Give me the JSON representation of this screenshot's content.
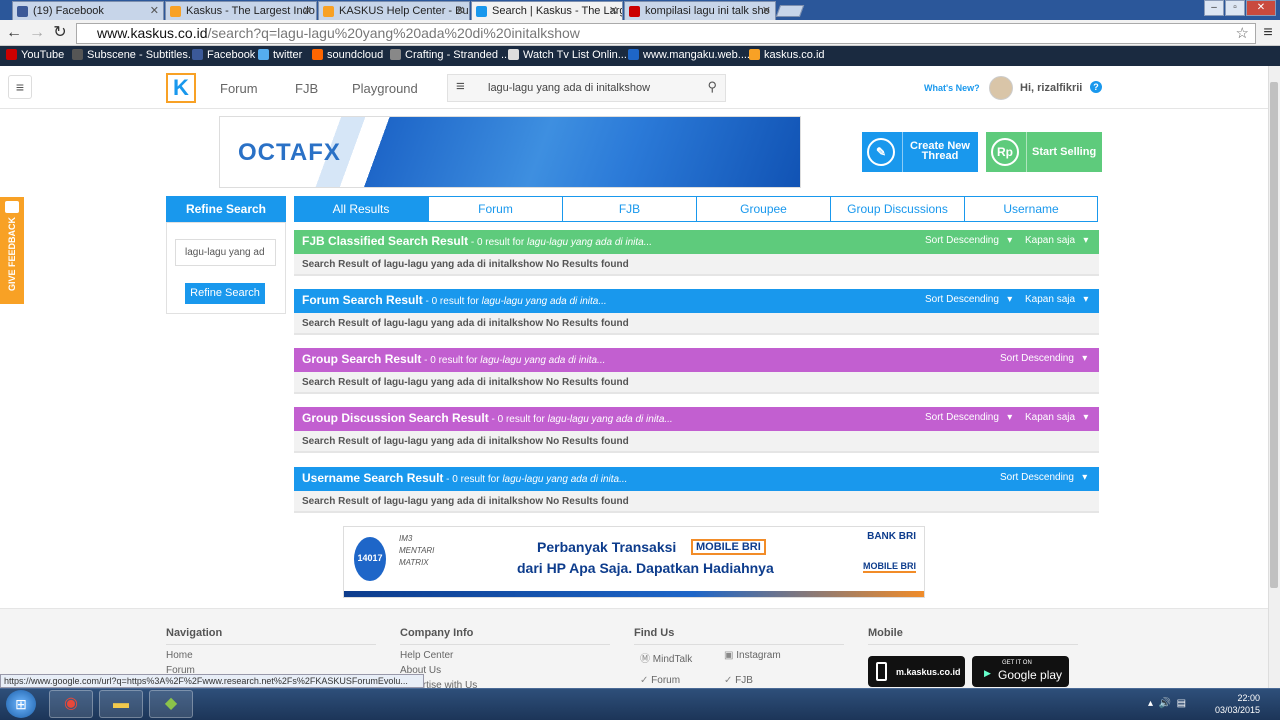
{
  "browser": {
    "tabs": [
      {
        "title": "(19) Facebook",
        "color": "#3b5998"
      },
      {
        "title": "Kaskus - The Largest Indo",
        "color": "#f8a125"
      },
      {
        "title": "KASKUS Help Center - Bu",
        "color": "#f8a125"
      },
      {
        "title": "Search | Kaskus - The Larg",
        "color": "#1998ed"
      },
      {
        "title": "kompilasi lagu ini talk sho",
        "color": "#cc0000"
      }
    ],
    "url_host": "www.kaskus.co.id",
    "url_rest": "/search?q=lagu-lagu%20yang%20ada%20di%20initalkshow",
    "bookmarks": [
      "YouTube",
      "Subscene - Subtitles...",
      "Facebook",
      "twitter",
      "soundcloud",
      "Crafting - Stranded ...",
      "Watch Tv List Onlin...",
      "www.mangaku.web....",
      "kaskus.co.id"
    ]
  },
  "header": {
    "logo": "K",
    "nav": [
      "Forum",
      "FJB",
      "Playground"
    ],
    "search_value": "lagu-lagu yang ada di initalkshow",
    "whats_new": "What's New?",
    "greeting": "Hi, rizalfikrii",
    "help": "?"
  },
  "ads": {
    "octafx": "OCTAFX",
    "bri_line1": "Perbanyak Transaksi",
    "bri_mobile": "MOBILE BRI",
    "bri_line2": "dari HP Apa Saja. Dapatkan Hadiahnya",
    "bri_phone": "14017",
    "bri_bank": "BANK BRI",
    "bri_mobile2": "MOBILE BRI",
    "bri_logo1": "IM3",
    "bri_logo2": "MENTARI",
    "bri_logo3": "MATRIX"
  },
  "actions": {
    "create_thread": "Create New Thread",
    "start_selling": "Start Selling"
  },
  "feedback": "GIVE FEEDBACK",
  "refine": {
    "title": "Refine Search",
    "input_value": "lagu-lagu yang ad",
    "button": "Refine Search"
  },
  "tabs": [
    "All Results",
    "Forum",
    "FJB",
    "Groupee",
    "Group Discussions",
    "Username"
  ],
  "results": [
    {
      "title": "FJB Classified Search Result",
      "count": " - 0 result for ",
      "query": "lagu-lagu yang ada di inita...",
      "sort": "Sort Descending",
      "time": "Kapan saja",
      "color": "#5ecb7c",
      "body": "Search Result of lagu-lagu yang ada di initalkshow No Results found"
    },
    {
      "title": "Forum Search Result",
      "count": " - 0 result for ",
      "query": "lagu-lagu yang ada di inita...",
      "sort": "Sort Descending",
      "time": "Kapan saja",
      "color": "#1998ed",
      "body": "Search Result of lagu-lagu yang ada di initalkshow No Results found"
    },
    {
      "title": "Group Search Result",
      "count": " - 0 result for ",
      "query": "lagu-lagu yang ada di inita...",
      "sort": "Sort Descending",
      "time": "",
      "color": "#c25fd0",
      "body": "Search Result of lagu-lagu yang ada di initalkshow No Results found"
    },
    {
      "title": "Group Discussion Search Result",
      "count": " - 0 result for ",
      "query": "lagu-lagu yang ada di inita...",
      "sort": "Sort Descending",
      "time": "Kapan saja",
      "color": "#c25fd0",
      "body": "Search Result of lagu-lagu yang ada di initalkshow No Results found"
    },
    {
      "title": "Username Search Result",
      "count": " - 0 result for ",
      "query": "lagu-lagu yang ada di inita...",
      "sort": "Sort Descending",
      "time": "",
      "color": "#1998ed",
      "body": "Search Result of lagu-lagu yang ada di initalkshow No Results found"
    }
  ],
  "footer": {
    "navigation": {
      "title": "Navigation",
      "links": [
        "Home",
        "Forum"
      ]
    },
    "company": {
      "title": "Company Info",
      "links": [
        "Help Center",
        "About Us",
        "Advertise with Us"
      ]
    },
    "find_us": {
      "title": "Find Us",
      "links": [
        "MindTalk",
        "Instagram",
        "Forum",
        "FJB"
      ]
    },
    "mobile": {
      "title": "Mobile",
      "site": "m.kaskus.co.id",
      "store_small": "GET IT ON",
      "store": "Google play"
    }
  },
  "status_url": "https://www.google.com/url?q=https%3A%2F%2Fwww.research.net%2Fs%2FKASKUSForumEvolu...",
  "taskbar": {
    "time": "22:00",
    "date": "03/03/2015"
  }
}
